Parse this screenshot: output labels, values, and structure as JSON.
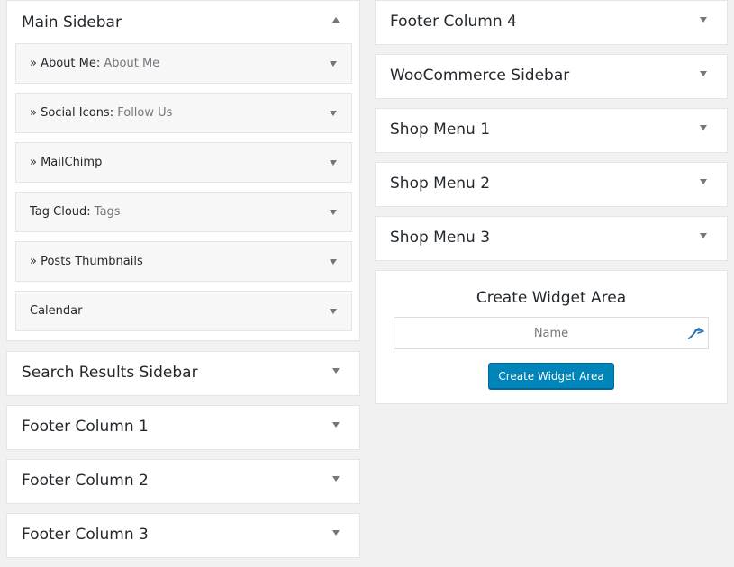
{
  "left_column": {
    "main_sidebar": {
      "title": "Main Sidebar",
      "widgets": [
        {
          "title": "» About Me:",
          "subtitle": " About Me"
        },
        {
          "title": "» Social Icons:",
          "subtitle": " Follow Us"
        },
        {
          "title": "» MailChimp",
          "subtitle": ""
        },
        {
          "title": "Tag Cloud:",
          "subtitle": " Tags"
        },
        {
          "title": "» Posts Thumbnails",
          "subtitle": ""
        },
        {
          "title": "Calendar",
          "subtitle": ""
        }
      ]
    },
    "sidebars": [
      {
        "title": "Search Results Sidebar"
      },
      {
        "title": "Footer Column 1"
      },
      {
        "title": "Footer Column 2"
      },
      {
        "title": "Footer Column 3"
      }
    ]
  },
  "right_column": {
    "sidebars": [
      {
        "title": "Footer Column 4"
      },
      {
        "title": "WooCommerce Sidebar"
      },
      {
        "title": "Shop Menu 1"
      },
      {
        "title": "Shop Menu 2"
      },
      {
        "title": "Shop Menu 3"
      }
    ],
    "create_widget_area": {
      "title": "Create Widget Area",
      "name_placeholder": "Name",
      "button_label": "Create Widget Area"
    }
  },
  "colors": {
    "button": "#0085ba",
    "background": "#f1f1f1",
    "accent_icon": "#2271b1"
  },
  "icons": {
    "collapse": "arrow-up-icon",
    "expand": "arrow-down-icon",
    "input": "autofill-icon"
  }
}
